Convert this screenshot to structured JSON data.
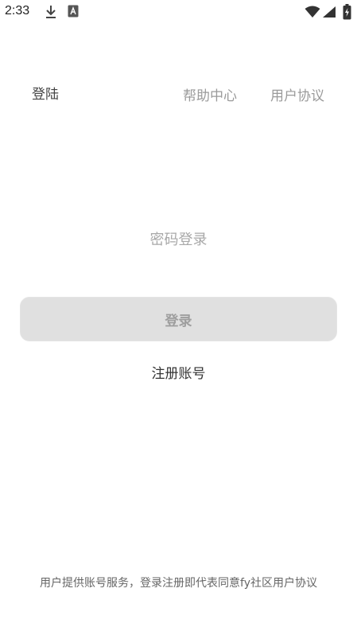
{
  "status_bar": {
    "time": "2:33",
    "icons": [
      "download-icon",
      "a-icon",
      "wifi-icon",
      "signal-icon",
      "battery-charging-icon"
    ]
  },
  "header": {
    "title": "登陆",
    "help_label": "帮助中心",
    "agreement_label": "用户协议"
  },
  "login": {
    "mode_label": "密码登录",
    "button_label": "登录",
    "register_label": "注册账号"
  },
  "footer": {
    "terms_text": "用户提供账号服务，登录注册即代表同意fy社区用户协议"
  },
  "colors": {
    "button_bg": "#e0e0e0",
    "muted_text": "#9a9a9a",
    "primary_text": "#333333"
  }
}
